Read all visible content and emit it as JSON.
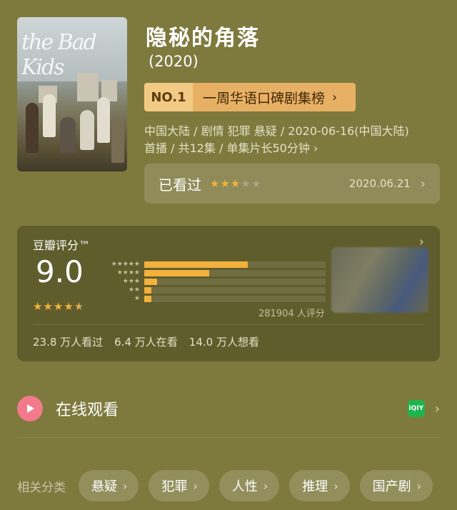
{
  "movie": {
    "title": "隐秘的角落",
    "year": "(2020)",
    "rank_no": "NO.1",
    "rank_board": "一周华语口碑剧集榜",
    "meta_line1": "中国大陆 / 剧情 犯罪 悬疑 / 2020-06-16(中国大陆)",
    "meta_line2": "首播 / 共12集 / 单集片长50分钟",
    "poster_scribble": "the Bad Kids"
  },
  "watched": {
    "label": "已看过",
    "rating_stars": 3,
    "date": "2020.06.21"
  },
  "douban": {
    "header": "豆瓣评分™",
    "score": "9.0",
    "score_stars": 4.5,
    "distribution": [
      {
        "stars": "★★★★★",
        "percent": 57
      },
      {
        "stars": "★★★★",
        "percent": 36
      },
      {
        "stars": "★★★",
        "percent": 7
      },
      {
        "stars": "★★",
        "percent": 4
      },
      {
        "stars": "★",
        "percent": 4
      }
    ],
    "rating_count": "281904 人评分",
    "stats": [
      "23.8 万人看过",
      "6.4 万人在看",
      "14.0 万人想看"
    ]
  },
  "online": {
    "label": "在线观看",
    "provider_icon": "iqiyi-icon",
    "provider_text": "iQIY"
  },
  "tags": {
    "label": "相关分类",
    "items": [
      "悬疑",
      "犯罪",
      "人性",
      "推理",
      "国产剧"
    ]
  },
  "colors": {
    "background": "#7e7a3e",
    "accent_star": "#f3b13c",
    "rank_no_bg": "#f3ca83",
    "rank_board_bg": "#e8b065",
    "play_button": "#f37a8d",
    "iqiyi_green": "#1db44e"
  }
}
